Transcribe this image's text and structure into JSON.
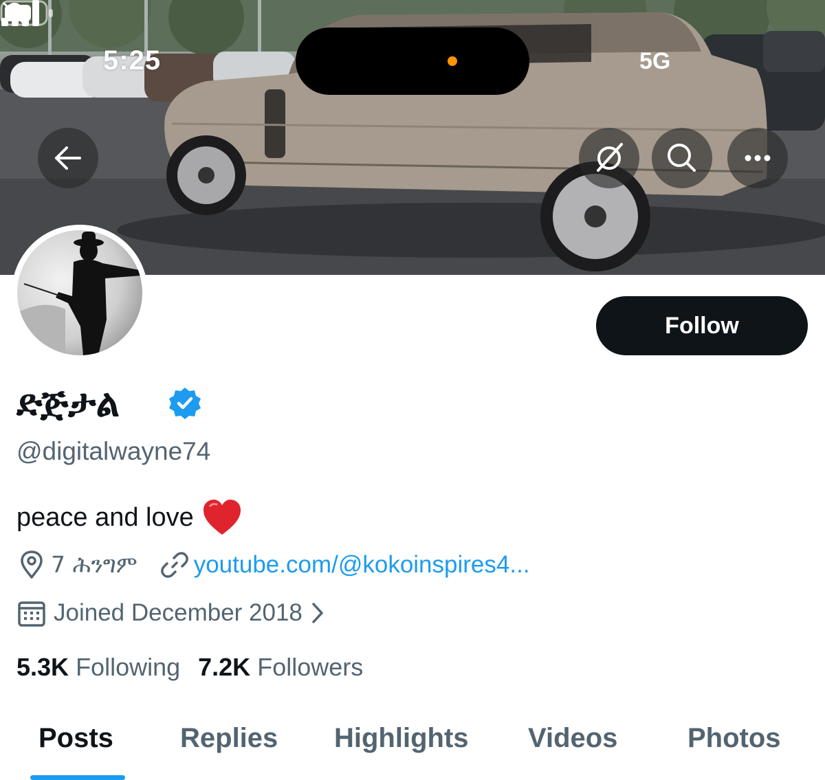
{
  "status_bar": {
    "time": "5:25",
    "network": "5G",
    "notification_icon": "bell-slash-icon",
    "privacy_indicator_color": "#ff9500"
  },
  "header": {
    "back_icon": "arrow-left-icon",
    "grok_icon": "grok-icon",
    "search_icon": "search-icon",
    "more_icon": "ellipsis-icon"
  },
  "profile": {
    "display_name": "ድጅታል",
    "verified": true,
    "handle": "@digitalwayne74",
    "bio": "peace and love",
    "bio_emoji": "red-heart",
    "location": "7 ሕንግም",
    "website": "youtube.com/@kokoinspires4...",
    "joined": "Joined December 2018",
    "following_count": "5.3K",
    "following_label": "Following",
    "followers_count": "7.2K",
    "followers_label": "Followers"
  },
  "actions": {
    "follow_label": "Follow"
  },
  "tabs": [
    {
      "label": "Posts",
      "active": true
    },
    {
      "label": "Replies",
      "active": false
    },
    {
      "label": "Highlights",
      "active": false
    },
    {
      "label": "Videos",
      "active": false
    },
    {
      "label": "Photos",
      "active": false
    }
  ],
  "colors": {
    "accent": "#1d9bf0",
    "text_primary": "#0f1419",
    "text_secondary": "#536471",
    "follow_button": "#0f1419"
  }
}
